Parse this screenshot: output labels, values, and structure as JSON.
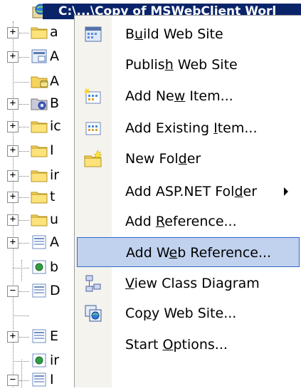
{
  "root": {
    "label": "C:\\...\\Copy of MSWebClient Worl"
  },
  "tree": [
    {
      "expander": "+",
      "icon": "folder",
      "label": "a"
    },
    {
      "expander": "+",
      "icon": "page",
      "label": "A"
    },
    {
      "expander": "",
      "icon": "database-folder",
      "label": "A"
    },
    {
      "expander": "+",
      "icon": "gear-folder",
      "label": "B"
    },
    {
      "expander": "+",
      "icon": "folder",
      "label": "ic"
    },
    {
      "expander": "+",
      "icon": "folder",
      "label": "I"
    },
    {
      "expander": "+",
      "icon": "folder",
      "label": "ir"
    },
    {
      "expander": "+",
      "icon": "folder",
      "label": "t"
    },
    {
      "expander": "+",
      "icon": "folder",
      "label": "u"
    },
    {
      "expander": "+",
      "icon": "webform",
      "label": "A"
    },
    {
      "expander": "",
      "icon": "webform-code",
      "label": "b"
    },
    {
      "expander": "−",
      "icon": "webform",
      "label": "D"
    },
    {
      "expander": "",
      "icon": "",
      "label": ""
    },
    {
      "expander": "+",
      "icon": "webform",
      "label": "E"
    },
    {
      "expander": "",
      "icon": "webform-code",
      "label": "ir"
    },
    {
      "expander": "−",
      "icon": "webform",
      "label": "I"
    }
  ],
  "menu": {
    "items": [
      {
        "pre": "B",
        "acc": "u",
        "post": "ild Web Site",
        "icon": "build-icon"
      },
      {
        "pre": "Publis",
        "acc": "h",
        "post": " Web Site",
        "icon": ""
      },
      {
        "pre": "Add Ne",
        "acc": "w",
        "post": " Item...",
        "icon": "add-new-item-icon"
      },
      {
        "pre": "Add Existing ",
        "acc": "I",
        "post": "tem...",
        "icon": "add-existing-item-icon"
      },
      {
        "pre": "New Fol",
        "acc": "d",
        "post": "er",
        "icon": "new-folder-icon"
      },
      {
        "pre": "Add ASP.NET Fol",
        "acc": "d",
        "post": "er",
        "icon": "",
        "submenu": true
      },
      {
        "pre": "Add ",
        "acc": "R",
        "post": "eference...",
        "icon": ""
      },
      {
        "pre": "Add W",
        "acc": "e",
        "post": "b Reference...",
        "icon": "",
        "selected": true
      },
      {
        "pre": "",
        "acc": "V",
        "post": "iew Class Diagram",
        "icon": "class-diagram-icon"
      },
      {
        "pre": "Co",
        "acc": "p",
        "post": "y Web Site...",
        "icon": "copy-web-site-icon"
      },
      {
        "pre": "Start ",
        "acc": "O",
        "post": "ptions...",
        "icon": ""
      }
    ]
  },
  "colors": {
    "selection_bg": "#c1d2ee",
    "selection_border": "#316ac5",
    "root_highlight": "#0a246a"
  }
}
